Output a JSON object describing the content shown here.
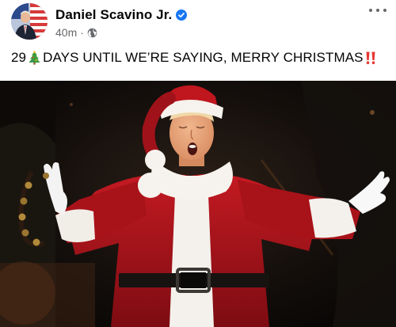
{
  "post": {
    "author_name": "Daniel Scavino Jr.",
    "timestamp": "40m",
    "separator": "·",
    "audience_icon": "globe-icon",
    "verified_icon": "verified-badge-icon",
    "more_icon": "more-options-icon",
    "text": {
      "prefix": "29",
      "emoji_1": "christmas-tree-icon",
      "body": "DAYS UNTIL WE’RE SAYING, MERRY CHRISTMAS",
      "emoji_2": "double-exclamation-icon"
    },
    "photo": {
      "subject": "man-in-santa-suit-singing"
    }
  },
  "colors": {
    "verified": "#1877f2",
    "text": "#050505",
    "secondary_text": "#65676b",
    "santa_red": "#b3141c",
    "fur_white": "#f4f1ec"
  }
}
